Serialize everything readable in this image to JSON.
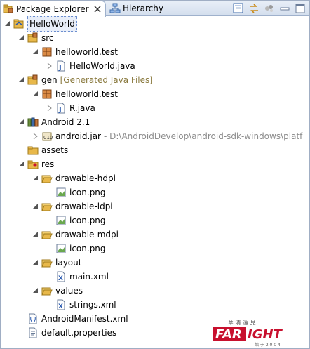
{
  "tabs": {
    "package_explorer": "Package Explorer",
    "hierarchy": "Hierarchy"
  },
  "tree": {
    "project": "HelloWorld",
    "src": "src",
    "pkg_src": "helloworld.test",
    "helloworld_java": "HelloWorld.java",
    "gen": "gen",
    "gen_decor": "[Generated Java Files]",
    "pkg_gen": "helloworld.test",
    "r_java": "R.java",
    "android": "Android 2.1",
    "android_jar": "android.jar",
    "android_jar_path": "- D:\\AndroidDevelop\\android-sdk-windows\\platf",
    "assets": "assets",
    "res": "res",
    "drawable_hdpi": "drawable-hdpi",
    "icon_hdpi": "icon.png",
    "drawable_ldpi": "drawable-ldpi",
    "icon_ldpi": "icon.png",
    "drawable_mdpi": "drawable-mdpi",
    "icon_mdpi": "icon.png",
    "layout": "layout",
    "main_xml": "main.xml",
    "values": "values",
    "strings_xml": "strings.xml",
    "manifest": "AndroidManifest.xml",
    "default_properties": "default.properties"
  },
  "watermark": {
    "brand_left": "FAR",
    "brand_right": "IGHT",
    "chinese": "華 清 遠 見",
    "tagline": "始 于 2 0 0 4"
  },
  "colors": {
    "folder": "#e8b84a",
    "package": "#c4763a",
    "brand_red": "#c8102e",
    "selection_border": "#6d8fcf"
  }
}
